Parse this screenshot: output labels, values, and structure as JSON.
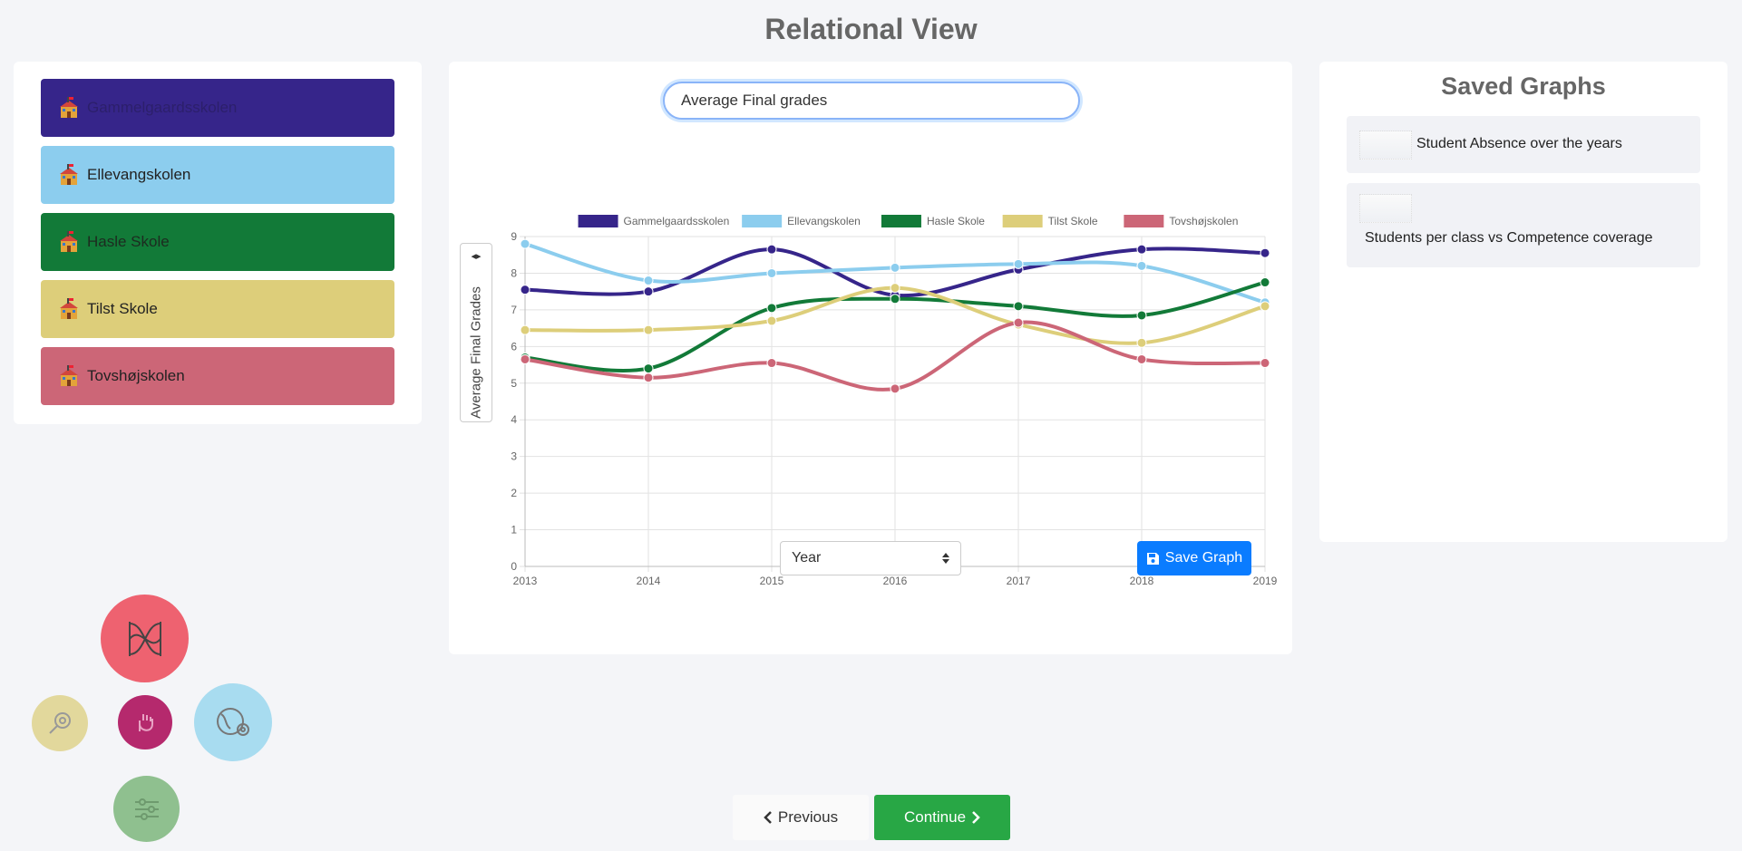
{
  "page": {
    "title": "Relational View"
  },
  "schools": [
    {
      "name": "Gammelgaardsskolen",
      "color": "#36258a",
      "text_color": "#2c1f6b",
      "icon": "school-icon"
    },
    {
      "name": "Ellevangskolen",
      "color": "#8ccdee",
      "text_color": "#222222",
      "icon": "school-icon"
    },
    {
      "name": "Hasle Skole",
      "color": "#127a38",
      "text_color": "#1d2b20",
      "icon": "school-icon"
    },
    {
      "name": "Tilst Skole",
      "color": "#ddce7a",
      "text_color": "#222222",
      "icon": "school-icon"
    },
    {
      "name": "Tovshøjskolen",
      "color": "#cc6677",
      "text_color": "#222222",
      "icon": "school-icon"
    }
  ],
  "graph": {
    "title_input_value": "Average Final grades",
    "y_axis_toggle_icon": "left-right-arrows-icon",
    "y_axis_button_label": "Average Final Grades",
    "x_axis_select_value": "Year",
    "save_button_label": "Save Graph",
    "save_icon": "floppy-disk-icon"
  },
  "chart_data": {
    "type": "line",
    "x": [
      "2013",
      "2014",
      "2015",
      "2016",
      "2017",
      "2018",
      "2019"
    ],
    "ylim": [
      0,
      9
    ],
    "yticks": [
      "0",
      "1",
      "2",
      "3",
      "4",
      "5",
      "6",
      "7",
      "8",
      "9"
    ],
    "grid": true,
    "legend_position": "top",
    "series": [
      {
        "name": "Gammelgaardsskolen",
        "color": "#36258a",
        "values": [
          7.55,
          7.5,
          8.65,
          7.4,
          8.1,
          8.65,
          8.55
        ]
      },
      {
        "name": "Ellevangskolen",
        "color": "#8ccdee",
        "values": [
          8.8,
          7.8,
          8.0,
          8.15,
          8.25,
          8.2,
          7.2
        ]
      },
      {
        "name": "Hasle Skole",
        "color": "#127a38",
        "values": [
          5.7,
          5.4,
          7.05,
          7.3,
          7.1,
          6.85,
          7.75
        ]
      },
      {
        "name": "Tilst Skole",
        "color": "#ddce7a",
        "values": [
          6.45,
          6.45,
          6.7,
          7.6,
          6.6,
          6.1,
          7.1
        ]
      },
      {
        "name": "Tovshøjskolen",
        "color": "#cc6677",
        "values": [
          5.65,
          5.15,
          5.55,
          4.85,
          6.65,
          5.65,
          5.55
        ]
      }
    ]
  },
  "saved_graphs": {
    "title": "Saved Graphs",
    "items": [
      {
        "label": "Student Absence over the years"
      },
      {
        "label": "Students per class vs Competence coverage"
      }
    ]
  },
  "tools": [
    {
      "icon": "relations-graph-icon",
      "color": "#ee6270"
    },
    {
      "icon": "magnifier-icon",
      "color": "#e2d89c"
    },
    {
      "icon": "hand-icon",
      "color": "#b5296d"
    },
    {
      "icon": "globe-icon",
      "color": "#a8dcf0"
    },
    {
      "icon": "sliders-icon",
      "color": "#8fc08f"
    }
  ],
  "navigation": {
    "previous_label": "Previous",
    "continue_label": "Continue",
    "previous_icon": "chevron-left-icon",
    "continue_icon": "chevron-right-icon"
  }
}
